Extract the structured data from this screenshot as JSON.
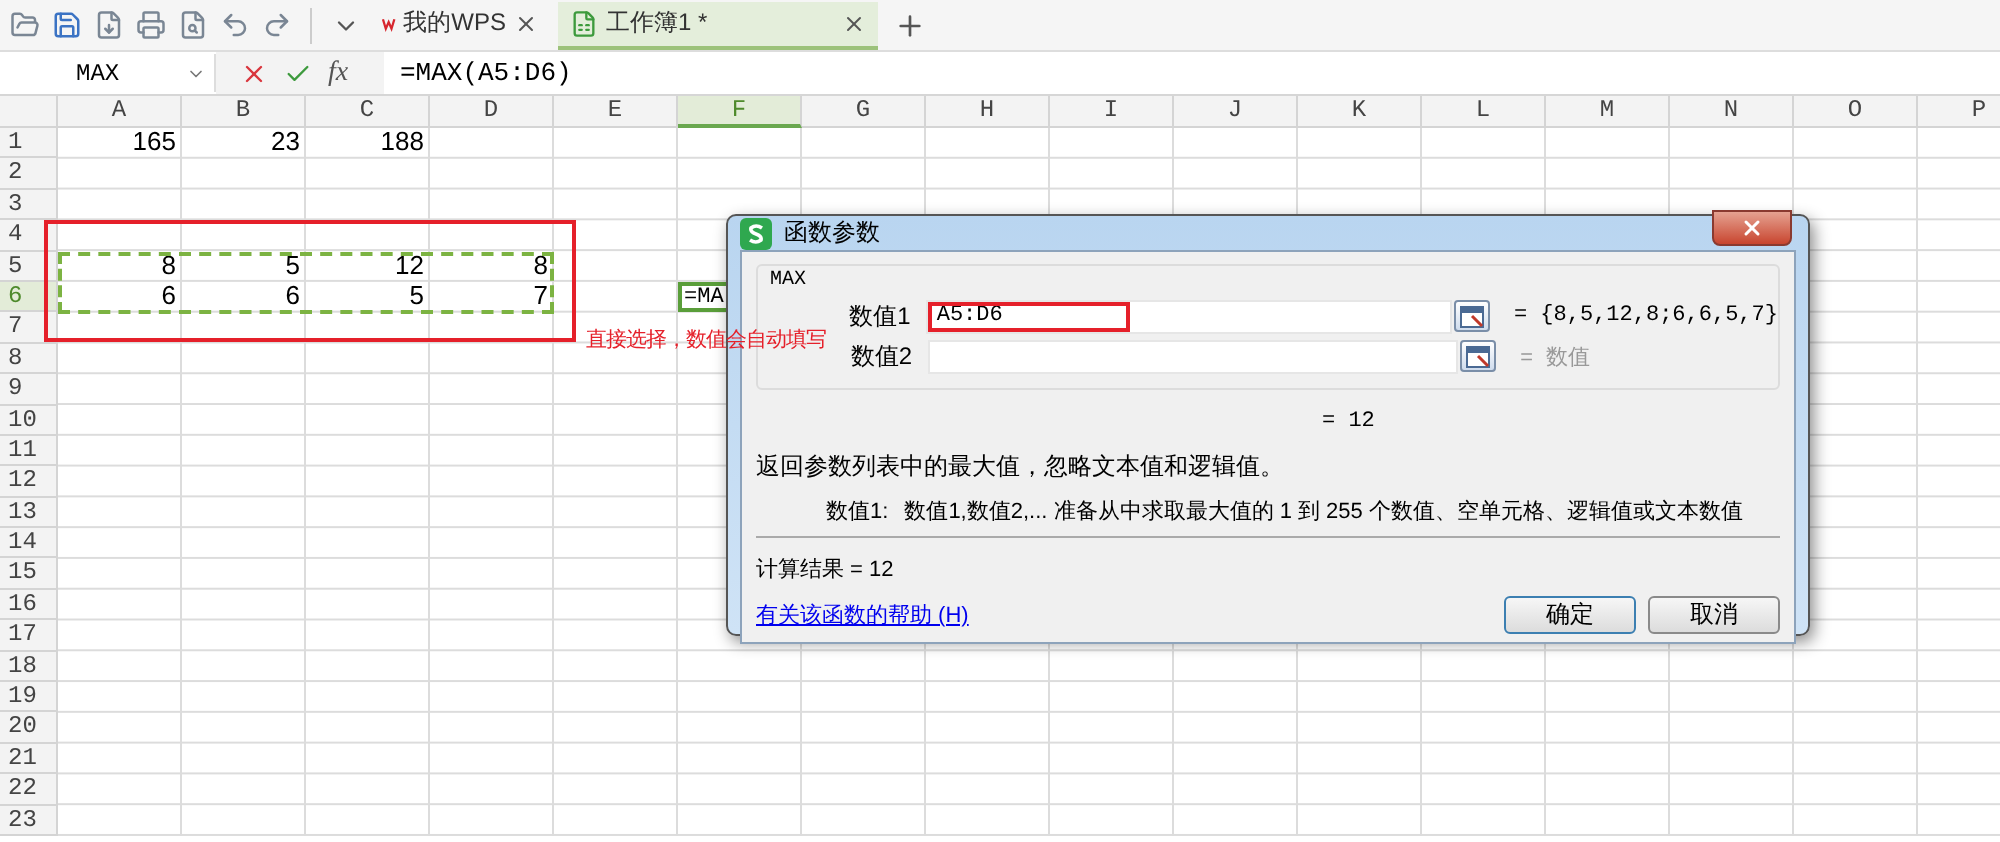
{
  "tabs": [
    {
      "label": "我的WPS",
      "kind": "home",
      "selected": false
    },
    {
      "label": "工作簿1 *",
      "kind": "sheet",
      "selected": true
    }
  ],
  "formula_bar": {
    "name_box": "MAX",
    "function_button": "fx",
    "formula": "=MAX(A5:D6)"
  },
  "sheet": {
    "columns": [
      {
        "label": "A",
        "selected": false
      },
      {
        "label": "B",
        "selected": false
      },
      {
        "label": "C",
        "selected": false
      },
      {
        "label": "D",
        "selected": false
      },
      {
        "label": "E",
        "selected": false
      },
      {
        "label": "F",
        "selected": true
      },
      {
        "label": "G",
        "selected": false
      },
      {
        "label": "H",
        "selected": false
      },
      {
        "label": "I",
        "selected": false
      },
      {
        "label": "J",
        "selected": false
      },
      {
        "label": "K",
        "selected": false
      },
      {
        "label": "L",
        "selected": false
      },
      {
        "label": "M",
        "selected": false
      },
      {
        "label": "N",
        "selected": false
      },
      {
        "label": "O",
        "selected": false
      },
      {
        "label": "P",
        "selected": false
      }
    ],
    "rows": [
      {
        "label": "1",
        "selected": false,
        "cells": [
          {
            "value": "165"
          },
          {
            "value": "23"
          },
          {
            "value": "188"
          }
        ]
      },
      {
        "label": "2",
        "selected": false,
        "cells": []
      },
      {
        "label": "3",
        "selected": false,
        "cells": []
      },
      {
        "label": "4",
        "selected": false,
        "cells": []
      },
      {
        "label": "5",
        "selected": false,
        "cells": [
          {
            "value": "8"
          },
          {
            "value": "5"
          },
          {
            "value": "12"
          },
          {
            "value": "8"
          }
        ]
      },
      {
        "label": "6",
        "selected": true,
        "cells": [
          {
            "value": "6"
          },
          {
            "value": "6"
          },
          {
            "value": "5"
          },
          {
            "value": "7"
          },
          {},
          {
            "value": "=MA",
            "active": true
          }
        ]
      },
      {
        "label": "7",
        "selected": false,
        "cells": []
      },
      {
        "label": "8",
        "selected": false,
        "cells": []
      },
      {
        "label": "9",
        "selected": false,
        "cells": []
      },
      {
        "label": "10",
        "selected": false,
        "cells": []
      },
      {
        "label": "11",
        "selected": false,
        "cells": []
      },
      {
        "label": "12",
        "selected": false,
        "cells": []
      },
      {
        "label": "13",
        "selected": false,
        "cells": []
      },
      {
        "label": "14",
        "selected": false,
        "cells": []
      },
      {
        "label": "15",
        "selected": false,
        "cells": []
      },
      {
        "label": "16",
        "selected": false,
        "cells": []
      },
      {
        "label": "17",
        "selected": false,
        "cells": []
      },
      {
        "label": "18",
        "selected": false,
        "cells": []
      },
      {
        "label": "19",
        "selected": false,
        "cells": []
      },
      {
        "label": "20",
        "selected": false,
        "cells": []
      },
      {
        "label": "21",
        "selected": false,
        "cells": []
      },
      {
        "label": "22",
        "selected": false,
        "cells": []
      },
      {
        "label": "23",
        "selected": false,
        "cells": []
      }
    ],
    "marquee": true
  },
  "annotation": {
    "text": "直接选择，数值会自动填写"
  },
  "dialog": {
    "title": "函数参数",
    "group": "MAX",
    "arguments": [
      {
        "label": "数值1",
        "value": "A5:D6",
        "highlighted": true,
        "result": "= {8,5,12,8;6,6,5,7}",
        "result_dim": false
      },
      {
        "label": "数值2",
        "highlighted": false,
        "result": "= 数值",
        "result_dim": true
      }
    ],
    "formula_result": "= 12",
    "description": "返回参数列表中的最大值，忽略文本值和逻辑值。",
    "arg_help_label": "数值1:",
    "arg_help": "数值1,数值2,... 准备从中求取最大值的 1 到 255 个数值、空单元格、逻辑值或文本数值",
    "result": "计算结果 = 12",
    "help_link": "有关该函数的帮助 (H)",
    "buttons": [
      {
        "label": "确定",
        "default": true
      },
      {
        "label": "取消",
        "default": false
      }
    ]
  }
}
